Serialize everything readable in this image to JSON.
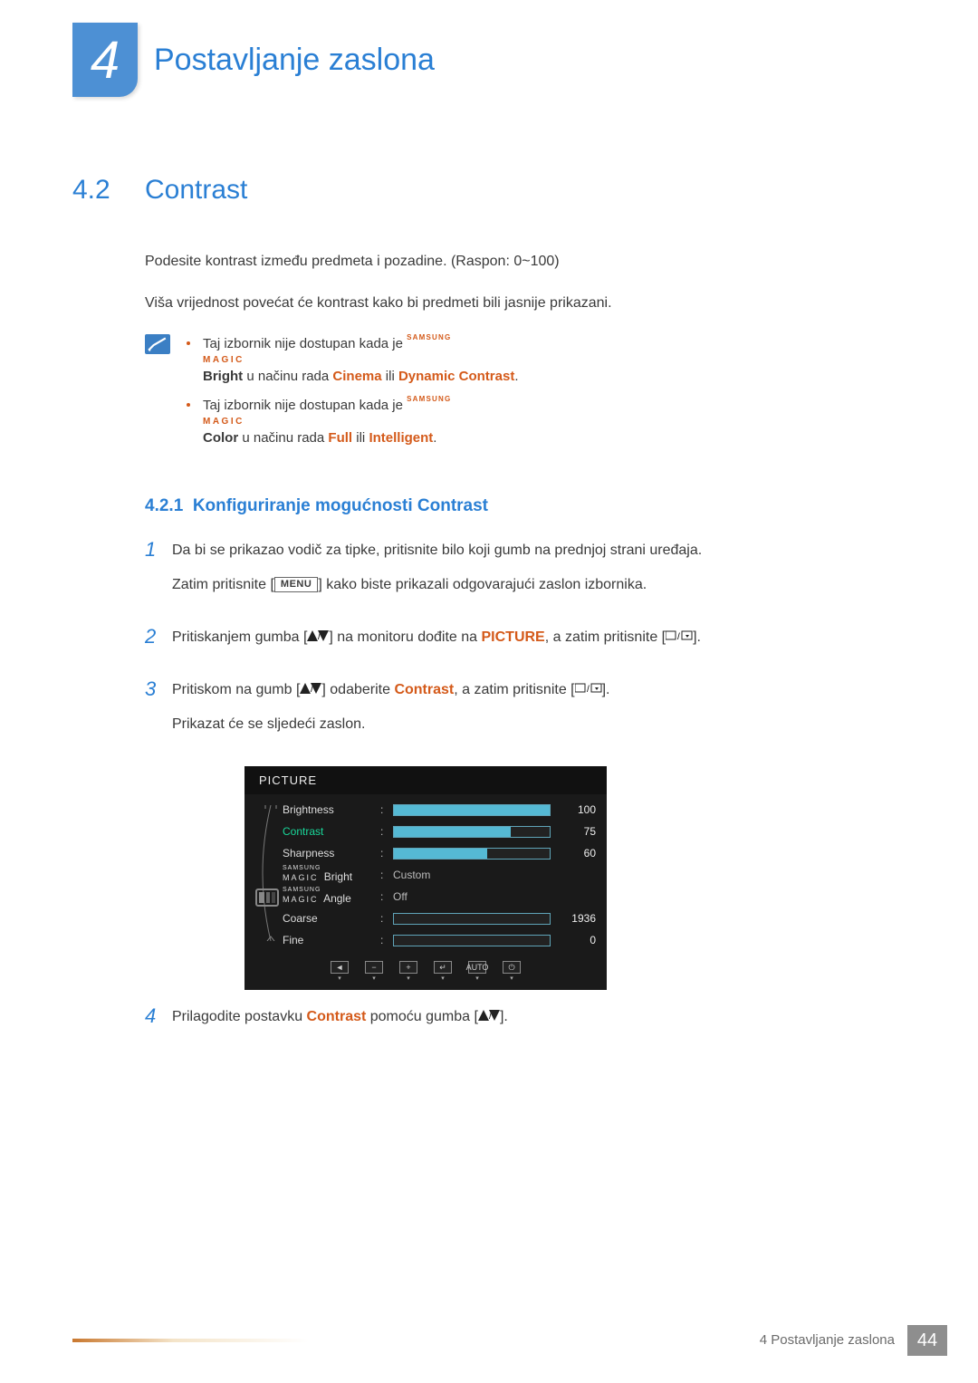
{
  "chapter": {
    "number": "4",
    "title": "Postavljanje zaslona"
  },
  "section": {
    "number": "4.2",
    "title": "Contrast"
  },
  "intro1": "Podesite kontrast između predmeta i pozadine. (Raspon: 0~100)",
  "intro2": "Viša vrijednost povećat će kontrast kako bi predmeti bili jasnije prikazani.",
  "notes": {
    "n1a": "Taj izbornik nije dostupan kada je ",
    "n1_magic": "Bright",
    "n1b": " u načinu rada ",
    "n1c": "Cinema",
    "n1d": " ili ",
    "n1e": "Dynamic Contrast",
    "n1f": ".",
    "n2a": "Taj izbornik nije dostupan kada je ",
    "n2_magic": "Color",
    "n2b": " u načinu rada ",
    "n2c": "Full",
    "n2d": " ili ",
    "n2e": "Intelligent",
    "n2f": "."
  },
  "magic": {
    "top": "SAMSUNG",
    "bottom": "MAGIC"
  },
  "subsection": {
    "number": "4.2.1",
    "title": "Konfiguriranje mogućnosti Contrast"
  },
  "steps": {
    "s1": {
      "num": "1",
      "a": "Da bi se prikazao vodič za tipke, pritisnite bilo koji gumb na prednjoj strani uređaja.",
      "b1": "Zatim pritisnite [",
      "menu": "MENU",
      "b2": "] kako biste prikazali odgovarajući zaslon izbornika."
    },
    "s2": {
      "num": "2",
      "a": "Pritiskanjem gumba [",
      "b": "] na monitoru dođite na ",
      "pic": "PICTURE",
      "c": ", a zatim pritisnite [",
      "d": "]."
    },
    "s3": {
      "num": "3",
      "a": "Pritiskom na gumb [",
      "b": "] odaberite ",
      "con": "Contrast",
      "c": ", a zatim pritisnite [",
      "d": "].",
      "e": "Prikazat će se sljedeći zaslon."
    },
    "s4": {
      "num": "4",
      "a": "Prilagodite postavku ",
      "con": "Contrast",
      "b": " pomoću gumba [",
      "c": "]."
    }
  },
  "osd": {
    "title": "PICTURE",
    "rows": [
      {
        "label": "Brightness",
        "value": "100",
        "fill": 100,
        "type": "bar"
      },
      {
        "label": "Contrast",
        "value": "75",
        "fill": 75,
        "type": "bar",
        "selected": true
      },
      {
        "label": "Sharpness",
        "value": "60",
        "fill": 60,
        "type": "bar"
      },
      {
        "magic": "Bright",
        "text": "Custom",
        "type": "text"
      },
      {
        "magic": "Angle",
        "text": "Off",
        "type": "text"
      },
      {
        "label": "Coarse",
        "value": "1936",
        "fill": 0,
        "type": "bar-empty"
      },
      {
        "label": "Fine",
        "value": "0",
        "fill": 0,
        "type": "bar-empty"
      }
    ],
    "nav": [
      "◄",
      "−",
      "+",
      "↵",
      "AUTO",
      "⏻"
    ]
  },
  "footer": {
    "text": "4 Postavljanje zaslona",
    "page": "44"
  }
}
